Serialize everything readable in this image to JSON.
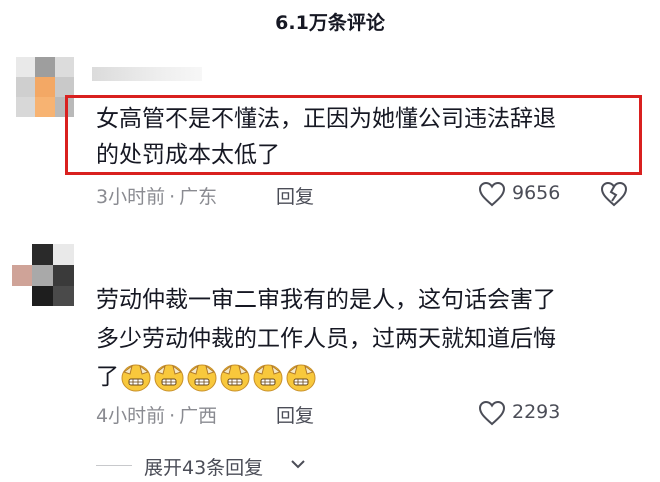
{
  "header": {
    "title": "6.1万条评论"
  },
  "comments": [
    {
      "text_line1": "女高管不是不懂法，正因为她懂公司违法辞退",
      "text_line2": "的处罚成本太低了",
      "time": "3小时前",
      "location": "广东",
      "reply_label": "回复",
      "likes": "9656"
    },
    {
      "text_line1": "劳动仲裁一审二审我有的是人，这句话会害了",
      "text_line2": "多少劳动仲裁的工作人员，过两天就知道后悔",
      "text_line3": "了",
      "time": "4小时前",
      "location": "广西",
      "reply_label": "回复",
      "likes": "2293"
    }
  ],
  "separator": "·",
  "expand_replies": "展开43条回复",
  "colors": {
    "highlight": "#d9201f",
    "meta": "#8a8b91",
    "text": "#161823"
  },
  "icons": [
    "heart-outline-icon",
    "broken-heart-icon",
    "grimacing-emoji-icon",
    "chevron-down-icon"
  ]
}
